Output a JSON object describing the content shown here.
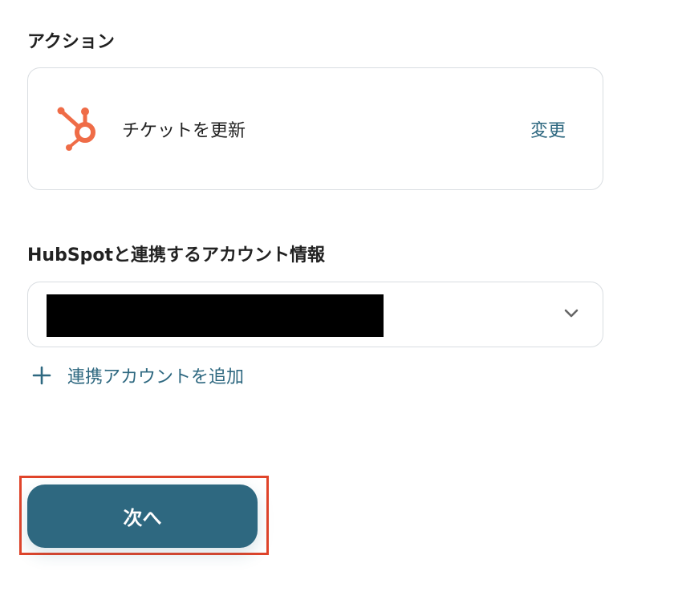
{
  "action_section": {
    "label": "アクション",
    "card": {
      "app_icon": "hubspot-icon",
      "action_name": "チケットを更新",
      "change_label": "変更"
    }
  },
  "account_section": {
    "label": "HubSpotと連携するアカウント情報",
    "select": {
      "value": "",
      "value_redacted": true,
      "icon": "chevron-down-icon"
    },
    "add_account": {
      "icon": "plus-icon",
      "label": "連携アカウントを追加"
    }
  },
  "footer": {
    "next_label": "次へ",
    "next_highlighted": true
  },
  "colors": {
    "primary": "#2e6880",
    "hubspot_orange": "#ef6c47",
    "highlight_red": "#e0442a",
    "border": "#d9dde1",
    "text": "#222222"
  }
}
